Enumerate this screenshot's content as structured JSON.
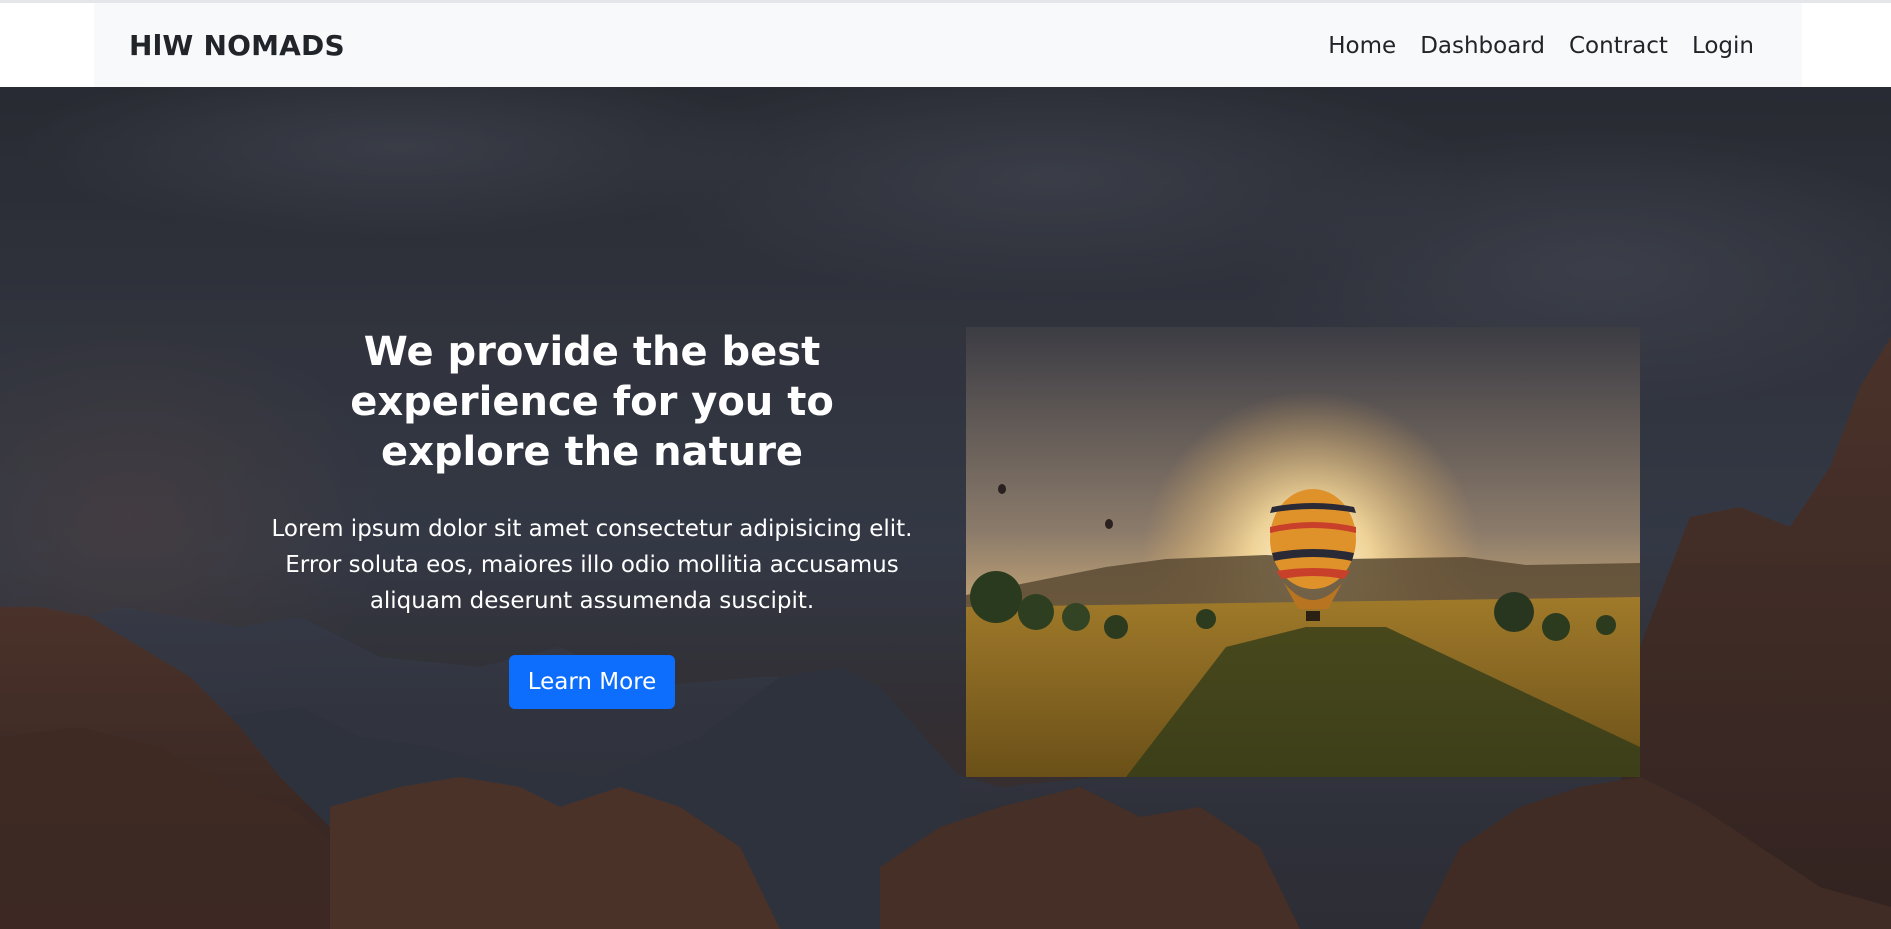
{
  "navbar": {
    "brand": "HlW NOMADS",
    "links": [
      {
        "label": "Home"
      },
      {
        "label": "Dashboard"
      },
      {
        "label": "Contract"
      },
      {
        "label": "Login"
      }
    ]
  },
  "hero": {
    "title": "We provide the best experience for you to explore the nature",
    "description": "Lorem ipsum dolor sit amet consectetur adipisicing elit. Error soluta eos, maiores illo odio mollitia accusamus aliquam deserunt assumenda suscipit.",
    "button_label": "Learn More",
    "background_image": "canyon-mountains-landscape",
    "feature_image": "hot-air-balloon-sunset-field"
  },
  "colors": {
    "accent": "#0d6efd",
    "navbar_bg": "#f8f9fa",
    "text_dark": "#212529"
  }
}
